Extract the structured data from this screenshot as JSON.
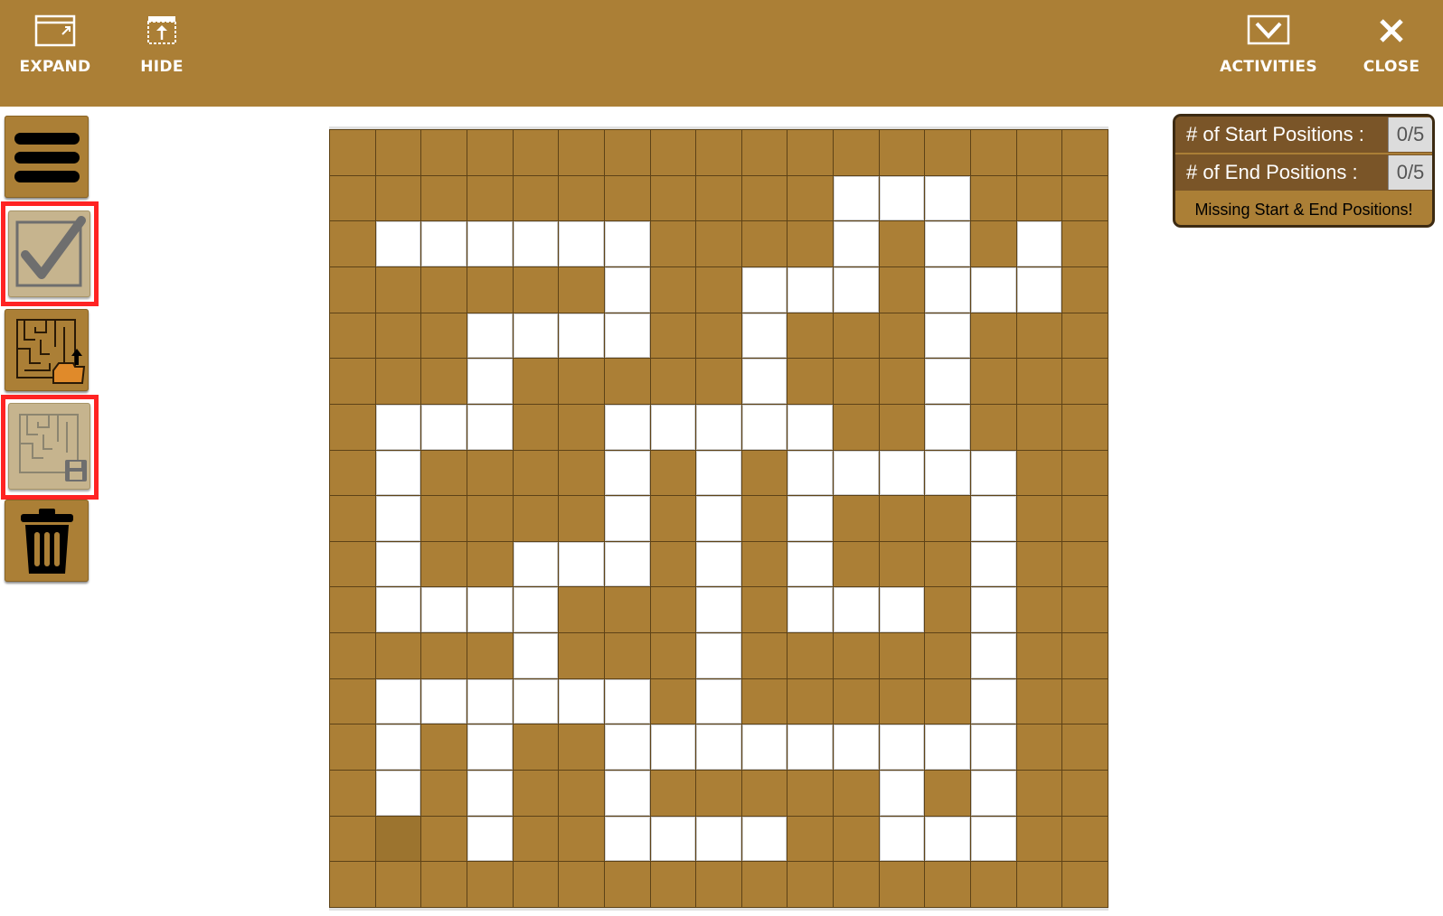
{
  "toolbar": {
    "expand_label": "EXPAND",
    "hide_label": "HIDE",
    "activities_label": "ACTIVITIES",
    "close_label": "CLOSE"
  },
  "sidebar": {
    "items": [
      {
        "name": "menu",
        "icon": "hamburger-icon"
      },
      {
        "name": "check",
        "icon": "checkmark-icon",
        "disabled": true,
        "highlighted": true
      },
      {
        "name": "load-maze",
        "icon": "maze-folder-icon"
      },
      {
        "name": "save-maze",
        "icon": "maze-save-icon",
        "disabled": true,
        "highlighted": true
      },
      {
        "name": "delete",
        "icon": "trash-icon"
      }
    ]
  },
  "maze": {
    "rows": [
      "#################",
      "###########...###",
      "#......####.#.#.#",
      "######.##...#...#",
      "###....##.###.###",
      "###.#####.###.###",
      "#...##.....##.###",
      "#.####.#.#.....##",
      "#.####.#.#.###.##",
      "#.##...#.#.###.##",
      "#....###.#...#.##",
      "####.###.#####.##",
      "#......#.#####.##",
      "#.#.##.........##",
      "#.#.##.#####.#.##",
      "#D#.##....##...##",
      "#################"
    ],
    "colors": {
      "wall": "#ab7f36",
      "path": "#ffffff",
      "grid": "#5d4217"
    }
  },
  "status": {
    "start_label": "# of Start Positions :",
    "start_value": "0/5",
    "end_label": "# of End Positions :",
    "end_value": "0/5",
    "message": "Missing Start & End Positions!"
  }
}
